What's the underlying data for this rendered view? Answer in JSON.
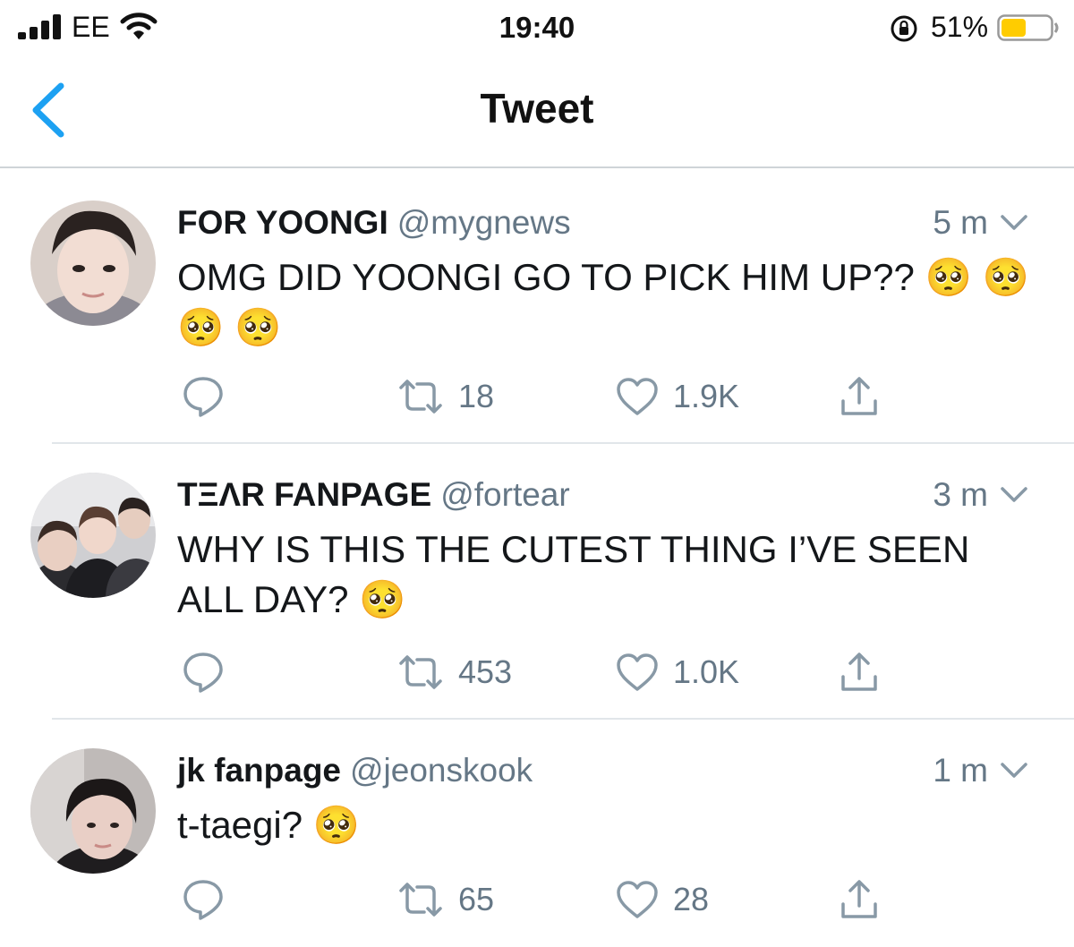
{
  "status_bar": {
    "carrier": "EE",
    "time": "19:40",
    "battery_percent": "51%",
    "battery_level": 0.51,
    "battery_color": "#ffcc00",
    "icons": [
      "signal-icon",
      "wifi-icon",
      "rotation-lock-icon",
      "battery-icon"
    ]
  },
  "nav": {
    "title": "Tweet",
    "back_icon": "chevron-left-icon",
    "accent_color": "#1da1f2"
  },
  "tweets": [
    {
      "display_name": "FOR YOONGI",
      "handle": "@mygnews",
      "time": "5 m",
      "text": "OMG DID YOONGI GO TO PICK HIM UP?? 🥺 🥺 🥺 🥺",
      "replies": "",
      "retweets": "18",
      "likes": "1.9K"
    },
    {
      "display_name": "TΞΛR FANPAGE",
      "handle": "@fortear",
      "time": "3 m",
      "text": "WHY IS THIS THE CUTEST THING I’VE SEEN ALL DAY? 🥺",
      "replies": "",
      "retweets": "453",
      "likes": "1.0K"
    },
    {
      "display_name": "jk fanpage",
      "handle": "@jeonskook",
      "time": "1 m",
      "text": "t-taegi? 🥺",
      "replies": "",
      "retweets": "65",
      "likes": "28"
    }
  ],
  "colors": {
    "text_primary": "#14171a",
    "text_secondary": "#657786",
    "divider": "#e1e6ea"
  }
}
